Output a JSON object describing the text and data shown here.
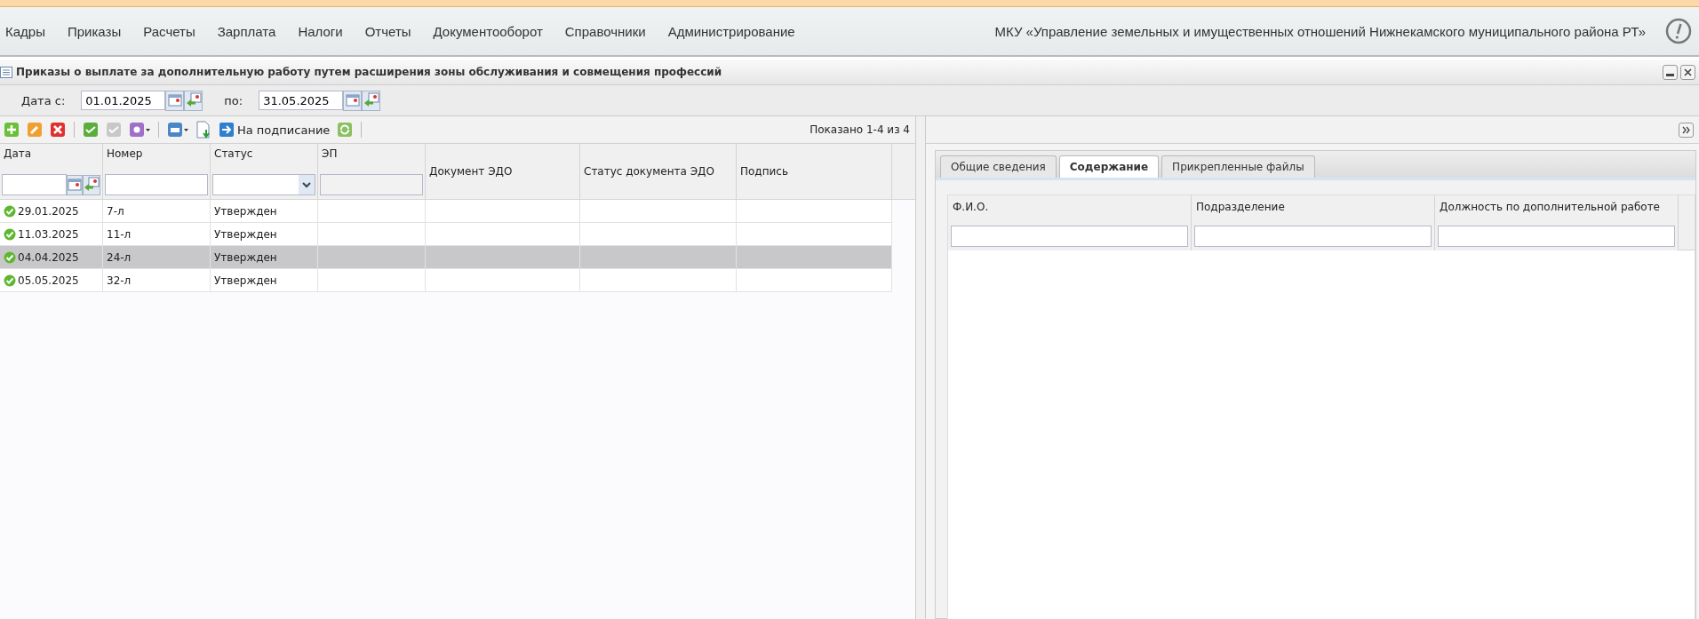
{
  "menu": {
    "items": [
      "Кадры",
      "Приказы",
      "Расчеты",
      "Зарплата",
      "Налоги",
      "Отчеты",
      "Документооборот",
      "Справочники",
      "Администрирование"
    ],
    "organization": "МКУ «Управление земельных и имущественных отношений Нижнекамского муниципального района РТ»"
  },
  "window": {
    "title": "Приказы о выплате за дополнительную работу путем расширения зоны обслуживания и совмещения профессий"
  },
  "date_filter": {
    "from_label": "Дата с:",
    "from_value": "01.01.2025",
    "to_label": "по:",
    "to_value": "31.05.2025"
  },
  "toolbar": {
    "sign_button": "На подписание",
    "paging": "Показано 1-4 из 4"
  },
  "table": {
    "columns": [
      {
        "label": "Дата",
        "kind": "date"
      },
      {
        "label": "Номер",
        "kind": "text"
      },
      {
        "label": "Статус",
        "kind": "select"
      },
      {
        "label": "ЭП",
        "kind": "readonly"
      },
      {
        "label": "Документ ЭДО",
        "kind": "none"
      },
      {
        "label": "Статус документа ЭДО",
        "kind": "none"
      },
      {
        "label": "Подпись",
        "kind": "none"
      }
    ],
    "rows": [
      {
        "date": "29.01.2025",
        "number": "7-л",
        "status": "Утвержден",
        "selected": false
      },
      {
        "date": "11.03.2025",
        "number": "11-л",
        "status": "Утвержден",
        "selected": false
      },
      {
        "date": "04.04.2025",
        "number": "24-л",
        "status": "Утвержден",
        "selected": true
      },
      {
        "date": "05.05.2025",
        "number": "32-л",
        "status": "Утвержден",
        "selected": false
      }
    ]
  },
  "detail": {
    "tabs": [
      {
        "label": "Общие сведения",
        "selected": false
      },
      {
        "label": "Содержание",
        "selected": true
      },
      {
        "label": "Прикрепленные файлы",
        "selected": false
      }
    ],
    "columns": [
      "Ф.И.О.",
      "Подразделение",
      "Должность по дополнительной работе"
    ]
  }
}
